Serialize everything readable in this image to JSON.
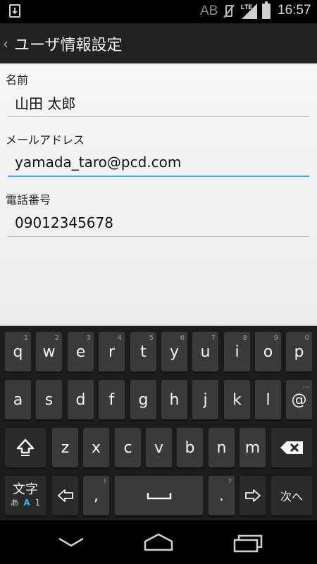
{
  "status_bar": {
    "ime_indicator": "AB",
    "network": "LTE",
    "time": "16:57"
  },
  "action_bar": {
    "title": "ユーザ情報設定"
  },
  "form": {
    "fields": [
      {
        "label": "名前",
        "value": "山田 太郎"
      },
      {
        "label": "メールアドレス",
        "value": "yamada_taro@pcd.com"
      },
      {
        "label": "電話番号",
        "value": "09012345678"
      }
    ]
  },
  "keyboard": {
    "row1": [
      {
        "key": "q",
        "hint": "1"
      },
      {
        "key": "w",
        "hint": "2"
      },
      {
        "key": "e",
        "hint": "3"
      },
      {
        "key": "r",
        "hint": "4"
      },
      {
        "key": "t",
        "hint": "5"
      },
      {
        "key": "y",
        "hint": "6"
      },
      {
        "key": "u",
        "hint": "7"
      },
      {
        "key": "i",
        "hint": "8"
      },
      {
        "key": "o",
        "hint": "9"
      },
      {
        "key": "p",
        "hint": "0"
      }
    ],
    "row2": [
      {
        "key": "a"
      },
      {
        "key": "s"
      },
      {
        "key": "d"
      },
      {
        "key": "f"
      },
      {
        "key": "g"
      },
      {
        "key": "h"
      },
      {
        "key": "j"
      },
      {
        "key": "k"
      },
      {
        "key": "l"
      },
      {
        "key": "@",
        "hint": "…"
      }
    ],
    "row3": [
      {
        "key": "z"
      },
      {
        "key": "x"
      },
      {
        "key": "c"
      },
      {
        "key": "v"
      },
      {
        "key": "b"
      },
      {
        "key": "n"
      },
      {
        "key": "m"
      }
    ],
    "mode_key": {
      "main": "文字",
      "sub1": "あ",
      "sub2": "A",
      "sub3": "1"
    },
    "comma": {
      "key": ",",
      "hint": "!"
    },
    "period": {
      "key": ".",
      "hint": "?"
    },
    "next_label": "次へ"
  },
  "colors": {
    "accent": "#33b5e5",
    "keyboard_bg": "#1c1c1c",
    "key_bg": "#3a3a3a"
  }
}
